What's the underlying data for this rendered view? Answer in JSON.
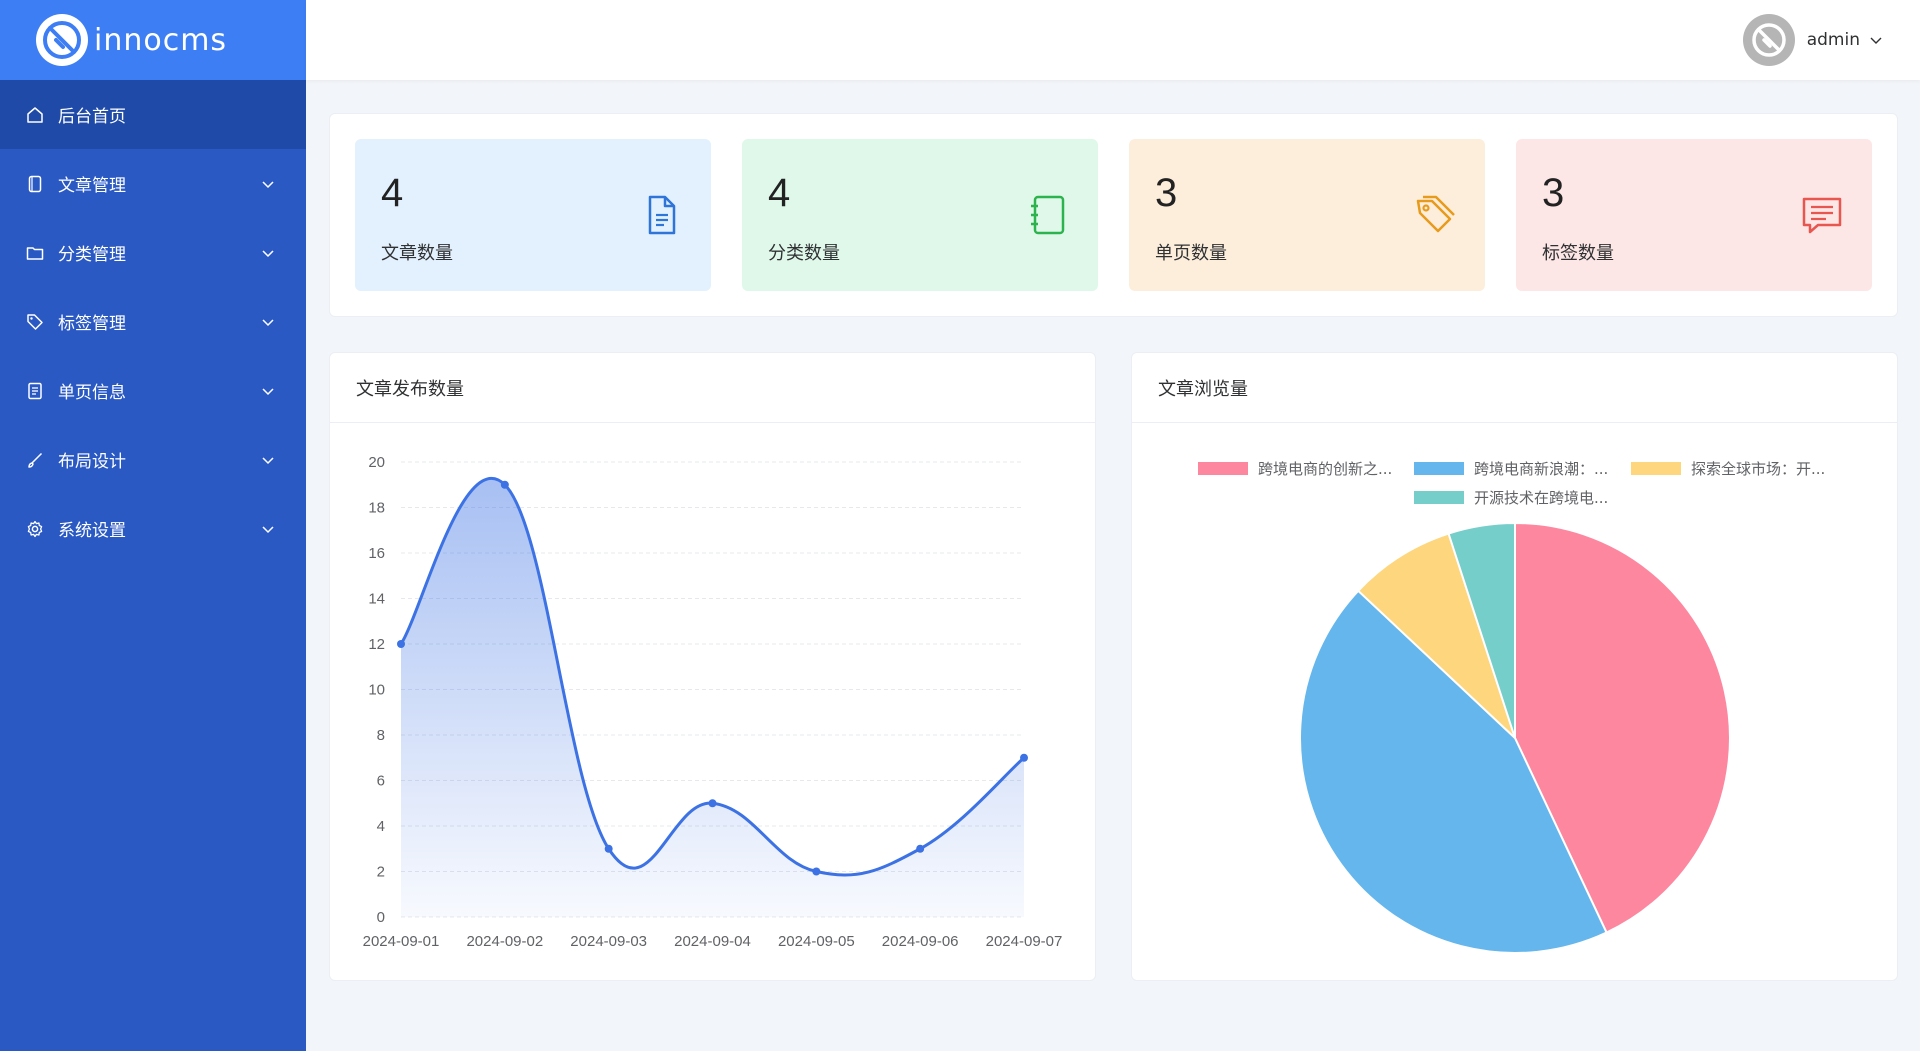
{
  "brand": {
    "name": "innocms"
  },
  "sidebar": {
    "items": [
      {
        "label": "后台首页",
        "icon": "home-icon",
        "active": true,
        "expandable": false
      },
      {
        "label": "文章管理",
        "icon": "document-icon",
        "expandable": true
      },
      {
        "label": "分类管理",
        "icon": "folder-icon",
        "expandable": true
      },
      {
        "label": "标签管理",
        "icon": "tag-icon",
        "expandable": true
      },
      {
        "label": "单页信息",
        "icon": "page-icon",
        "expandable": true
      },
      {
        "label": "布局设计",
        "icon": "brush-icon",
        "expandable": true
      },
      {
        "label": "系统设置",
        "icon": "gear-icon",
        "expandable": true
      }
    ]
  },
  "header": {
    "user": {
      "name": "admin"
    }
  },
  "stats": [
    {
      "value": "4",
      "label": "文章数量",
      "icon": "document-icon",
      "bg": "#e2f1fd",
      "color": "#2f74d8"
    },
    {
      "value": "4",
      "label": "分类数量",
      "icon": "notebook-icon",
      "bg": "#dff8ea",
      "color": "#2db34e"
    },
    {
      "value": "3",
      "label": "单页数量",
      "icon": "tag-icon",
      "bg": "#fdeedc",
      "color": "#e79b1c"
    },
    {
      "value": "3",
      "label": "标签数量",
      "icon": "message-icon",
      "bg": "#fde6e6",
      "color": "#e8574f"
    }
  ],
  "panels": {
    "line_title": "文章发布数量",
    "pie_title": "文章浏览量"
  },
  "chart_data": [
    {
      "type": "area",
      "categories": [
        "2024-09-01",
        "2024-09-02",
        "2024-09-03",
        "2024-09-04",
        "2024-09-05",
        "2024-09-06",
        "2024-09-07"
      ],
      "values": [
        12,
        19,
        3,
        5,
        2,
        3,
        7
      ],
      "ylim": [
        0,
        20
      ],
      "yticks": [
        0,
        2,
        4,
        6,
        8,
        10,
        12,
        14,
        16,
        18,
        20
      ],
      "grid": true,
      "smooth": true,
      "color": "#3c72e4"
    },
    {
      "type": "pie",
      "labels": [
        "跨境电商的创新之...",
        "跨境电商新浪潮：...",
        "探索全球市场：开...",
        "开源技术在跨境电..."
      ],
      "values": [
        43,
        44,
        8,
        5
      ],
      "colors": [
        "#fe87a0",
        "#64b6ec",
        "#fdd67e",
        "#76cecb"
      ],
      "legend": "top"
    }
  ]
}
